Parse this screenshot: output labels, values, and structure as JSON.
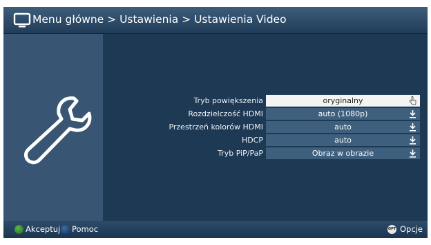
{
  "header": {
    "title": "Menu główne > Ustawienia > Ustawienia Video",
    "icon": "tv-icon"
  },
  "sidebar": {
    "icon": "wrench-icon"
  },
  "settings": [
    {
      "label": "Tryb powiększenia",
      "value": "oryginalny",
      "selected": true
    },
    {
      "label": "Rozdzielczość HDMI",
      "value": "auto (1080p)",
      "selected": false
    },
    {
      "label": "Przestrzeń kolorów HDMI",
      "value": "auto",
      "selected": false
    },
    {
      "label": "HDCP",
      "value": "auto",
      "selected": false
    },
    {
      "label": "Tryb PiP/PaP",
      "value": "Obraz w obrazie",
      "selected": false
    }
  ],
  "footer": {
    "accept_label": "Akceptuj",
    "help_label": "Pomoc",
    "options_badge": "OPT",
    "options_label": "Opcje",
    "accept_color": "#3fa03a",
    "help_color": "#2a5b94"
  }
}
